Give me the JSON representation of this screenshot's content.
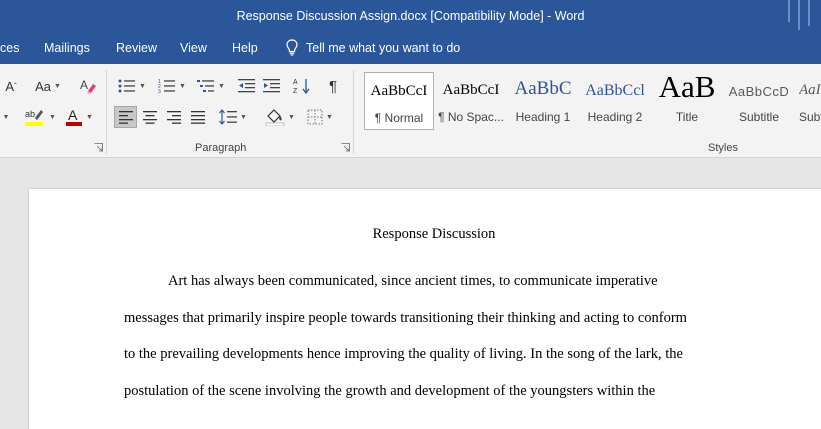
{
  "titlebar": {
    "title": "Response Discussion Assign.docx [Compatibility Mode]  -  Word"
  },
  "tabs": [
    {
      "label": "ces"
    },
    {
      "label": "Mailings"
    },
    {
      "label": "Review"
    },
    {
      "label": "View"
    },
    {
      "label": "Help"
    }
  ],
  "tell_me": {
    "label": "Tell me what you want to do"
  },
  "ribbon": {
    "font": {
      "change_case_label": "Aa",
      "grow_label": "A"
    },
    "paragraph": {
      "label": "Paragraph"
    },
    "styles": {
      "label": "Styles",
      "items": [
        {
          "preview": "AaBbCcI",
          "name": "¶ Normal"
        },
        {
          "preview": "AaBbCcI",
          "name": "¶ No Spac..."
        },
        {
          "preview": "AaBbC",
          "name": "Heading 1"
        },
        {
          "preview": "AaBbCcl",
          "name": "Heading 2"
        },
        {
          "preview": "AaB",
          "name": "Title"
        },
        {
          "preview": "AaBbCcD",
          "name": "Subtitle"
        },
        {
          "preview": "AaI",
          "name": "Subt"
        }
      ]
    }
  },
  "colors": {
    "accent": "#2b579a",
    "highlight": "#ffff00",
    "font_color": "#c00000"
  },
  "document": {
    "title": "Response Discussion",
    "lines": [
      "Art has always been communicated, since ancient times, to communicate imperative",
      "messages that primarily inspire people towards transitioning their thinking and acting to conform",
      "to the prevailing developments hence improving the quality of living. In the song of the lark, the",
      "postulation of the scene involving the growth and development of the youngsters within the"
    ]
  }
}
